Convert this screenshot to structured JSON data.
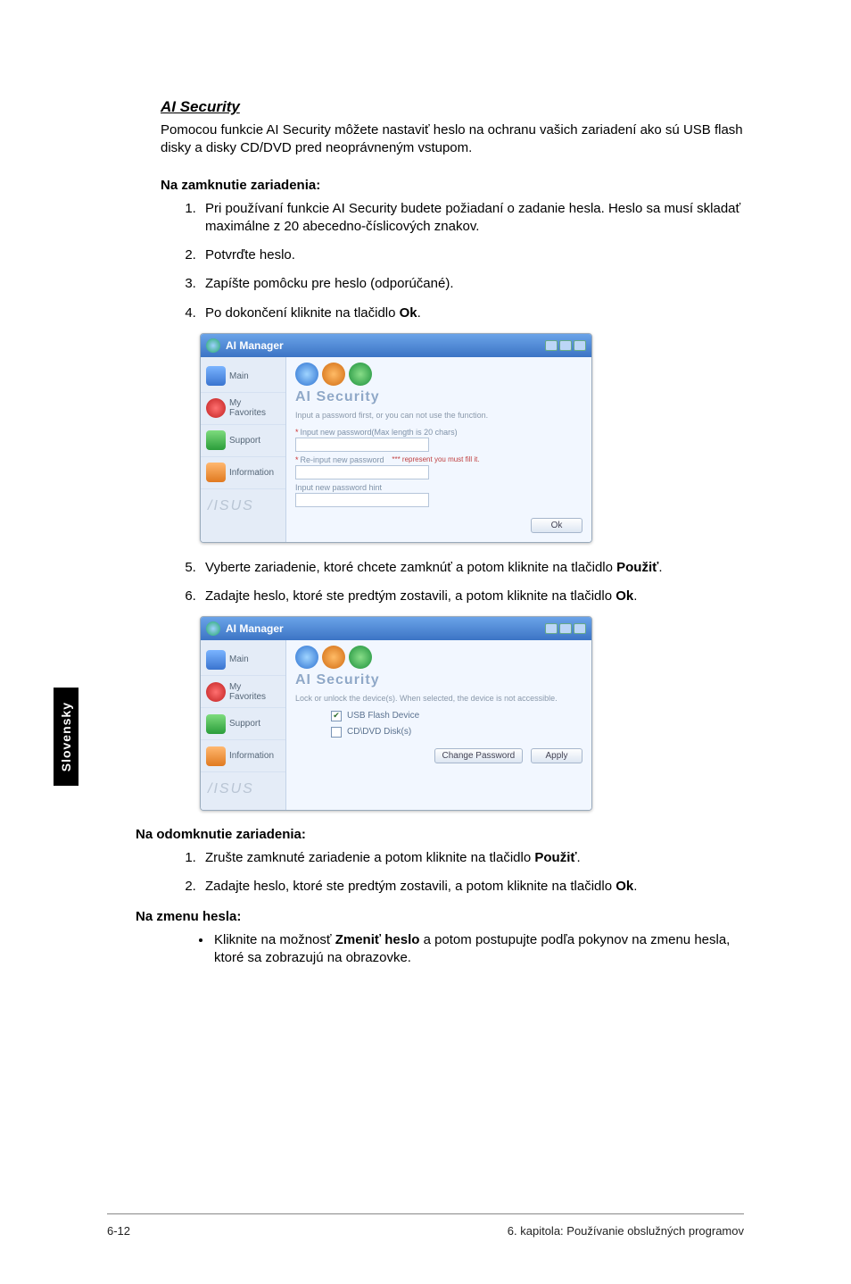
{
  "side_tab": "Slovensky",
  "section": {
    "title": "AI Security",
    "intro": "Pomocou funkcie AI Security môžete nastaviť heslo na ochranu vašich zariadení ako sú USB flash disky a disky CD/DVD pred neoprávneným vstupom."
  },
  "lock": {
    "heading": "Na zamknutie zariadenia:",
    "steps": {
      "s1": "Pri používaní funkcie AI Security budete požiadaní o zadanie hesla. Heslo sa musí skladať maximálne z 20 abecedno-číslicových znakov.",
      "s2": "Potvrďte heslo.",
      "s3": "Zapíšte pomôcku pre heslo (odporúčané).",
      "s4_a": "Po dokončení kliknite na tlačidlo ",
      "s4_b": "Ok",
      "s4_c": ".",
      "s5_a": "Vyberte zariadenie, ktoré chcete zamknúť a potom kliknite na tlačidlo ",
      "s5_b": "Použiť",
      "s5_c": ".",
      "s6_a": "Zadajte heslo, ktoré ste predtým zostavili, a potom kliknite na tlačidlo ",
      "s6_b": "Ok",
      "s6_c": "."
    }
  },
  "unlock": {
    "heading": "Na odomknutie zariadenia:",
    "steps": {
      "s1_a": "Zrušte zamknuté zariadenie a potom kliknite na tlačidlo ",
      "s1_b": "Použiť",
      "s1_c": ".",
      "s2_a": "Zadajte heslo, ktoré ste predtým zostavili, a potom kliknite na tlačidlo ",
      "s2_b": "Ok",
      "s2_c": "."
    }
  },
  "change": {
    "heading": "Na zmenu hesla:",
    "bullet_a": "Kliknite na možnosť ",
    "bullet_b": "Zmeniť heslo",
    "bullet_c": " a potom postupujte podľa pokynov na zmenu hesla, ktoré sa zobrazujú na obrazovke."
  },
  "app": {
    "title": "AI Manager",
    "brand": "/ISUS",
    "sidebar": {
      "main": "Main",
      "favorites": "My Favorites",
      "support": "Support",
      "information": "Information"
    },
    "panel_title": "AI Security",
    "shot1": {
      "sub": "Input a password first, or you can not use the function.",
      "lbl1": "Input new password(Max length is 20 chars)",
      "lbl2": "Re-input new password",
      "lbl3": "Input new password hint",
      "hint": "*** represent you must fill it.",
      "ok": "Ok"
    },
    "shot2": {
      "sub": "Lock or unlock the device(s). When selected, the device is not accessible.",
      "dev1": "USB Flash Device",
      "dev2": "CD\\DVD Disk(s)",
      "btn_change": "Change Password",
      "btn_apply": "Apply"
    }
  },
  "footer": {
    "left": "6-12",
    "right": "6. kapitola: Používanie obslužných programov"
  }
}
